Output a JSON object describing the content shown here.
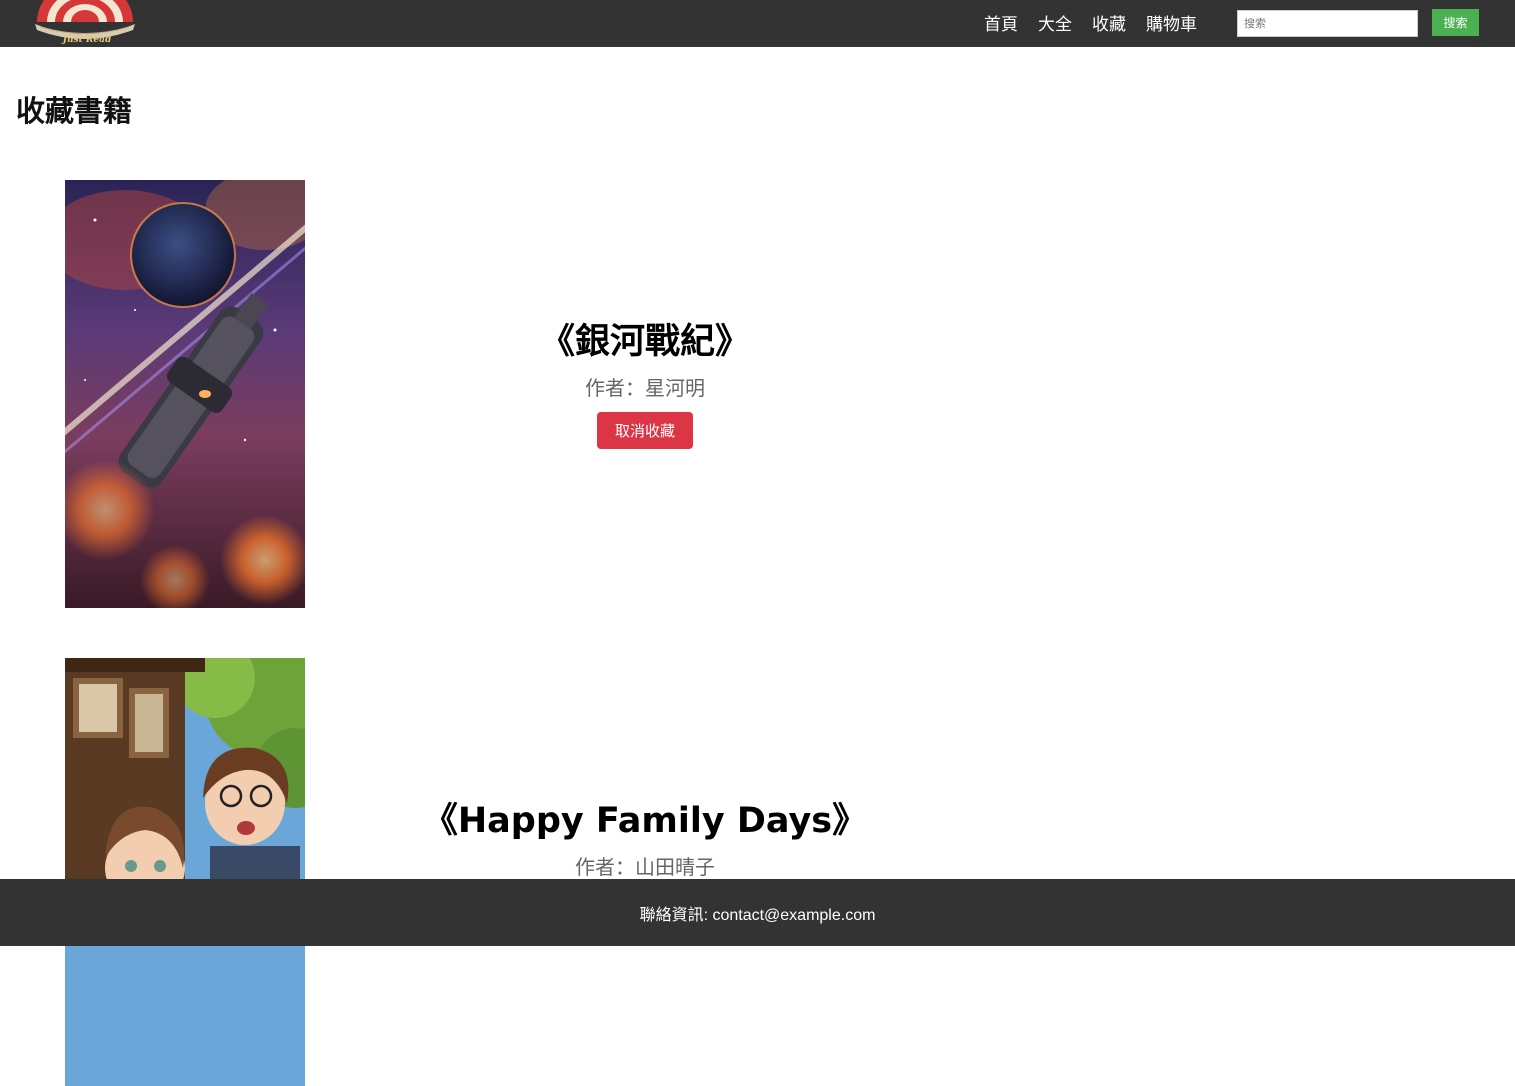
{
  "header": {
    "logo_text": "Just Read",
    "nav": [
      {
        "label": "首頁"
      },
      {
        "label": "大全"
      },
      {
        "label": "收藏"
      },
      {
        "label": "購物車"
      }
    ],
    "search": {
      "placeholder": "搜索",
      "button_label": "搜索"
    }
  },
  "page": {
    "title": "收藏書籍"
  },
  "books": [
    {
      "title": "《銀河戰紀》",
      "author": "作者：星河明",
      "unfavorite_label": "取消收藏",
      "cover": "spaceship-galaxy-illustration"
    },
    {
      "title": "《Happy Family Days》",
      "author": "作者：山田晴子",
      "cover": "anime-family-illustration"
    }
  ],
  "footer": {
    "contact_text": "聯絡資訊: contact@example.com"
  },
  "colors": {
    "nav_bg": "#333333",
    "search_button": "#4caf50",
    "unfavorite_button": "#dc3545",
    "logo_red": "#d6383a",
    "logo_gold": "#e8c77a"
  }
}
